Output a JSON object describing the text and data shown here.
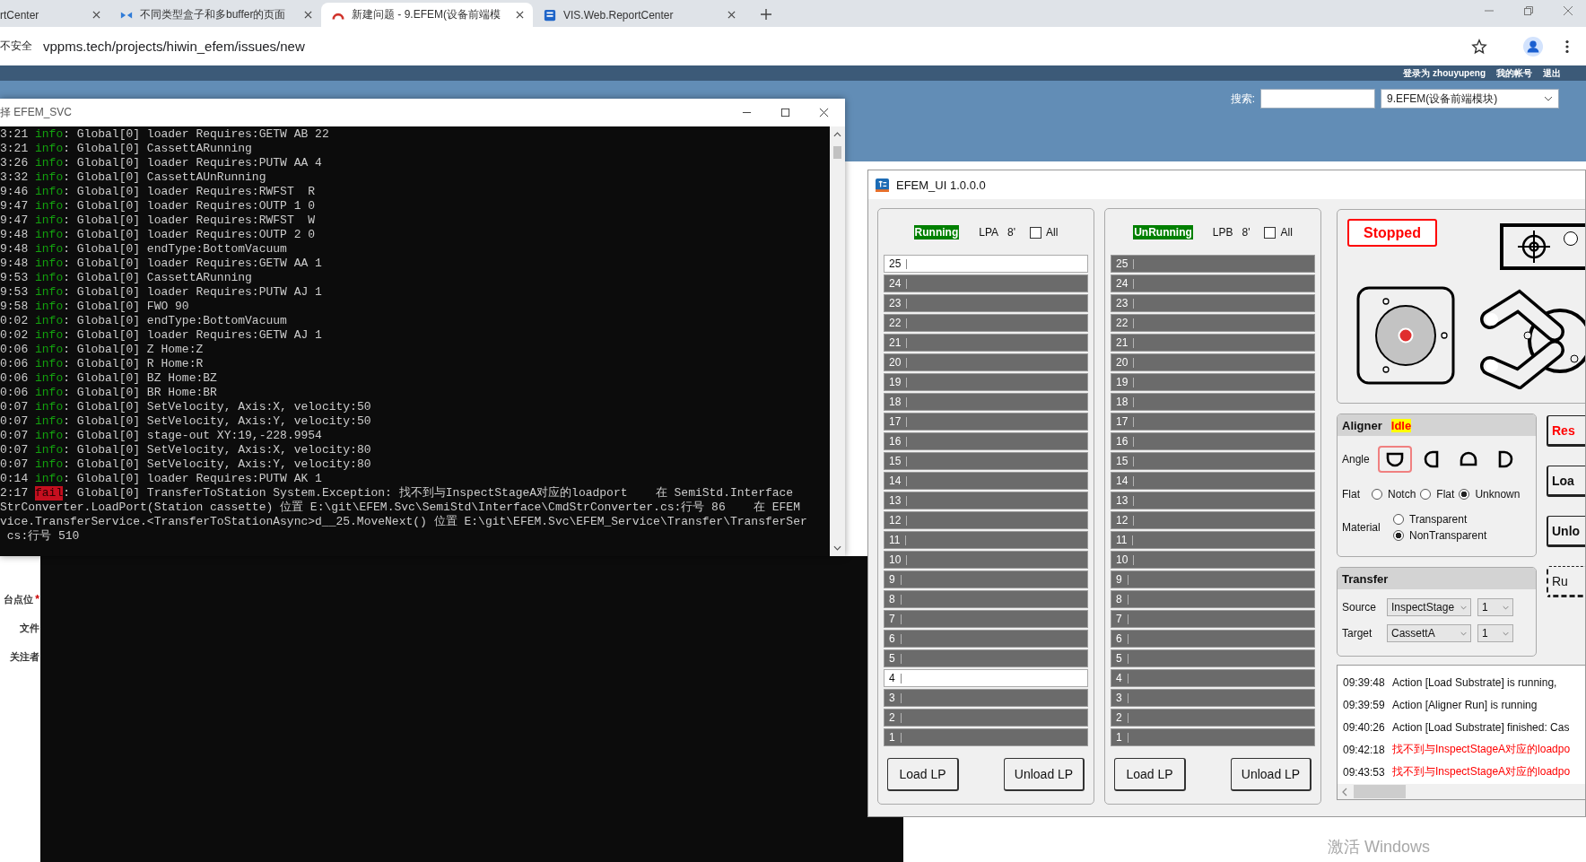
{
  "browser": {
    "tabs": [
      {
        "title": "rtCenter",
        "kind": "plain",
        "selected": false
      },
      {
        "title": "不同类型盒子和多buffer的页面",
        "kind": "bird",
        "selected": false
      },
      {
        "title": "新建问题 - 9.EFEM(设备前端模",
        "kind": "arc",
        "selected": true
      },
      {
        "title": "VIS.Web.ReportCenter",
        "kind": "document",
        "selected": false
      }
    ],
    "security": "不安全",
    "url": "vppms.tech/projects/hiwin_efem/issues/new"
  },
  "page": {
    "user_links": [
      "登录为 zhouyupeng",
      "我的帐号",
      "退出"
    ],
    "search_label": "搜索:",
    "project": "9.EFEM(设备前端模块)",
    "form_labels": [
      {
        "text": "台点位",
        "required_mark": "*"
      },
      {
        "text": "文件"
      },
      {
        "text": "关注者"
      }
    ]
  },
  "console": {
    "title": "择 EFEM_SVC",
    "lines": [
      {
        "kind": "log",
        "time": "3:21",
        "level": "info",
        "message": ": Global[0] loader Requires:GETW AB 22"
      },
      {
        "kind": "log",
        "time": "3:21",
        "level": "info",
        "message": ": Global[0] CassettARunning"
      },
      {
        "kind": "log",
        "time": "3:26",
        "level": "info",
        "message": ": Global[0] loader Requires:PUTW AA 4"
      },
      {
        "kind": "log",
        "time": "3:32",
        "level": "info",
        "message": ": Global[0] CassettAUnRunning"
      },
      {
        "kind": "log",
        "time": "9:46",
        "level": "info",
        "message": ": Global[0] loader Requires:RWFST  R"
      },
      {
        "kind": "log",
        "time": "9:47",
        "level": "info",
        "message": ": Global[0] loader Requires:OUTP 1 0"
      },
      {
        "kind": "log",
        "time": "9:47",
        "level": "info",
        "message": ": Global[0] loader Requires:RWFST  W"
      },
      {
        "kind": "log",
        "time": "9:48",
        "level": "info",
        "message": ": Global[0] loader Requires:OUTP 2 0"
      },
      {
        "kind": "log",
        "time": "9:48",
        "level": "info",
        "message": ": Global[0] endType:BottomVacuum"
      },
      {
        "kind": "log",
        "time": "9:48",
        "level": "info",
        "message": ": Global[0] loader Requires:GETW AA 1"
      },
      {
        "kind": "log",
        "time": "9:53",
        "level": "info",
        "message": ": Global[0] CassettARunning"
      },
      {
        "kind": "log",
        "time": "9:53",
        "level": "info",
        "message": ": Global[0] loader Requires:PUTW AJ 1"
      },
      {
        "kind": "log",
        "time": "9:58",
        "level": "info",
        "message": ": Global[0] FWO 90"
      },
      {
        "kind": "log",
        "time": "0:02",
        "level": "info",
        "message": ": Global[0] endType:BottomVacuum"
      },
      {
        "kind": "log",
        "time": "0:02",
        "level": "info",
        "message": ": Global[0] loader Requires:GETW AJ 1"
      },
      {
        "kind": "log",
        "time": "0:06",
        "level": "info",
        "message": ": Global[0] Z Home:Z"
      },
      {
        "kind": "log",
        "time": "0:06",
        "level": "info",
        "message": ": Global[0] R Home:R"
      },
      {
        "kind": "log",
        "time": "0:06",
        "level": "info",
        "message": ": Global[0] BZ Home:BZ"
      },
      {
        "kind": "log",
        "time": "0:06",
        "level": "info",
        "message": ": Global[0] BR Home:BR"
      },
      {
        "kind": "log",
        "time": "0:07",
        "level": "info",
        "message": ": Global[0] SetVelocity, Axis:X, velocity:50"
      },
      {
        "kind": "log",
        "time": "0:07",
        "level": "info",
        "message": ": Global[0] SetVelocity, Axis:Y, velocity:50"
      },
      {
        "kind": "log",
        "time": "0:07",
        "level": "info",
        "message": ": Global[0] stage-out XY:19,-228.9954"
      },
      {
        "kind": "log",
        "time": "0:07",
        "level": "info",
        "message": ": Global[0] SetVelocity, Axis:X, velocity:80"
      },
      {
        "kind": "log",
        "time": "0:07",
        "level": "info",
        "message": ": Global[0] SetVelocity, Axis:Y, velocity:80"
      },
      {
        "kind": "log",
        "time": "0:14",
        "level": "info",
        "message": ": Global[0] loader Requires:PUTW AK 1"
      },
      {
        "kind": "log",
        "time": "2:17",
        "level": "fail",
        "message": ": Global[0] TransferToStation System.Exception: 找不到与InspectStageA对应的loadport    在 SemiStd.Interface"
      },
      {
        "kind": "wrap",
        "message": "StrConverter.LoadPort(Station cassette) 位置 E:\\git\\EFEM.Svc\\SemiStd\\Interface\\CmdStrConverter.cs:行号 86    在 EFEM"
      },
      {
        "kind": "wrap",
        "message": "vice.TransferService.<TransferToStationAsync>d__25.MoveNext() 位置 E:\\git\\EFEM.Svc\\EFEM_Service\\Transfer\\TransferSer"
      },
      {
        "kind": "wrap",
        "message": " cs:行号 510"
      }
    ]
  },
  "efem": {
    "title": "EFEM_UI 1.0.0.0",
    "ports": [
      {
        "status": "Running",
        "name": "LPA",
        "size": "8'",
        "all_label": "All",
        "all_checked": false,
        "load_button": "Load LP",
        "unload_button": "Unload LP",
        "slots": [
          {
            "number": "25",
            "loaded": true
          },
          {
            "number": "24",
            "loaded": false
          },
          {
            "number": "23",
            "loaded": false
          },
          {
            "number": "22",
            "loaded": false
          },
          {
            "number": "21",
            "loaded": false
          },
          {
            "number": "20",
            "loaded": false
          },
          {
            "number": "19",
            "loaded": false
          },
          {
            "number": "18",
            "loaded": false
          },
          {
            "number": "17",
            "loaded": false
          },
          {
            "number": "16",
            "loaded": false
          },
          {
            "number": "15",
            "loaded": false
          },
          {
            "number": "14",
            "loaded": false
          },
          {
            "number": "13",
            "loaded": false
          },
          {
            "number": "12",
            "loaded": false
          },
          {
            "number": "11",
            "loaded": false
          },
          {
            "number": "10",
            "loaded": false
          },
          {
            "number": "9",
            "loaded": false
          },
          {
            "number": "8",
            "loaded": false
          },
          {
            "number": "7",
            "loaded": false
          },
          {
            "number": "6",
            "loaded": false
          },
          {
            "number": "5",
            "loaded": false
          },
          {
            "number": "4",
            "loaded": true
          },
          {
            "number": "3",
            "loaded": false
          },
          {
            "number": "2",
            "loaded": false
          },
          {
            "number": "1",
            "loaded": false
          }
        ]
      },
      {
        "status": "UnRunning",
        "name": "LPB",
        "size": "8'",
        "all_label": "All",
        "all_checked": false,
        "load_button": "Load LP",
        "unload_button": "Unload LP",
        "slots": [
          {
            "number": "25",
            "loaded": false
          },
          {
            "number": "24",
            "loaded": false
          },
          {
            "number": "23",
            "loaded": false
          },
          {
            "number": "22",
            "loaded": false
          },
          {
            "number": "21",
            "loaded": false
          },
          {
            "number": "20",
            "loaded": false
          },
          {
            "number": "19",
            "loaded": false
          },
          {
            "number": "18",
            "loaded": false
          },
          {
            "number": "17",
            "loaded": false
          },
          {
            "number": "16",
            "loaded": false
          },
          {
            "number": "15",
            "loaded": false
          },
          {
            "number": "14",
            "loaded": false
          },
          {
            "number": "13",
            "loaded": false
          },
          {
            "number": "12",
            "loaded": false
          },
          {
            "number": "11",
            "loaded": false
          },
          {
            "number": "10",
            "loaded": false
          },
          {
            "number": "9",
            "loaded": false
          },
          {
            "number": "8",
            "loaded": false
          },
          {
            "number": "7",
            "loaded": false
          },
          {
            "number": "6",
            "loaded": false
          },
          {
            "number": "5",
            "loaded": false
          },
          {
            "number": "4",
            "loaded": false
          },
          {
            "number": "3",
            "loaded": false
          },
          {
            "number": "2",
            "loaded": false
          },
          {
            "number": "1",
            "loaded": false
          }
        ]
      }
    ],
    "state": "Stopped",
    "aligner": {
      "title": "Aligner",
      "status": "Idle",
      "angle_label": "Angle",
      "angles": [
        {
          "kind": "flat-top",
          "selected": true
        },
        {
          "kind": "flat-right",
          "selected": false
        },
        {
          "kind": "flat-bottom",
          "selected": false
        },
        {
          "kind": "flat-left",
          "selected": false
        }
      ],
      "flat_label": "Flat",
      "flat_options": [
        {
          "label": "Notch",
          "selected": false
        },
        {
          "label": "Flat",
          "selected": false
        },
        {
          "label": "Unknown",
          "selected": true
        }
      ],
      "material_label": "Material",
      "material_options": [
        {
          "label": "Transparent",
          "selected": false
        },
        {
          "label": "NonTransparent",
          "selected": true
        }
      ]
    },
    "transfer": {
      "title": "Transfer",
      "rows": [
        {
          "label": "Source",
          "station": "InspectStage",
          "slot": "1"
        },
        {
          "label": "Target",
          "station": "CassettA",
          "slot": "1"
        }
      ]
    },
    "side_buttons": [
      {
        "label": "Res",
        "kind": "alert"
      },
      {
        "label": "Loa",
        "kind": "bold"
      },
      {
        "label": "Unlo",
        "kind": "bold"
      },
      {
        "label": "Ru",
        "kind": "focused"
      }
    ],
    "log": [
      {
        "time": "09:39:48",
        "message": "Action [Load Substrate] is running,",
        "kind": "info"
      },
      {
        "time": "09:39:59",
        "message": "Action [Aligner Run] is running",
        "kind": "info"
      },
      {
        "time": "09:40:26",
        "message": "Action [Load Substrate] finished: Cas",
        "kind": "info"
      },
      {
        "time": "09:42:18",
        "message": "找不到与InspectStageA对应的loadpo",
        "kind": "error"
      },
      {
        "time": "09:43:53",
        "message": "找不到与InspectStageA对应的loadpo",
        "kind": "error"
      }
    ]
  },
  "os_notice": "激活 Windows"
}
